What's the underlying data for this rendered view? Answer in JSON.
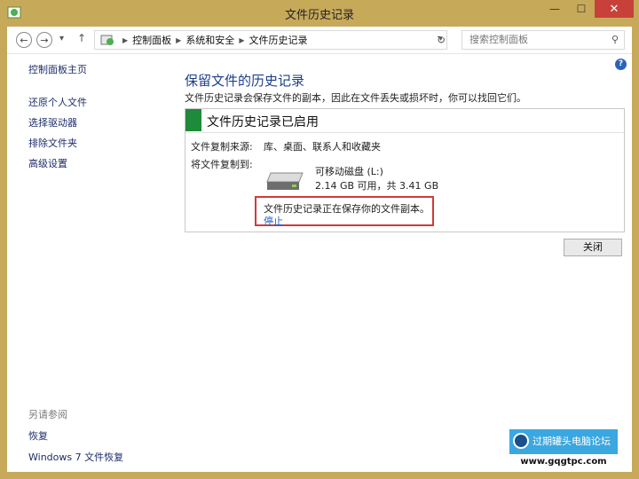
{
  "window": {
    "title": "文件历史记录",
    "minimize": "—",
    "maximize": "☐",
    "close": "✕"
  },
  "address": {
    "crumbs": [
      "控制面板",
      "系统和安全",
      "文件历史记录"
    ],
    "search_placeholder": "搜索控制面板"
  },
  "sidebar": {
    "home": "控制面板主页",
    "items": [
      "还原个人文件",
      "选择驱动器",
      "排除文件夹",
      "高级设置"
    ],
    "see_also_header": "另请参阅",
    "see_also": [
      "恢复",
      "Windows 7 文件恢复"
    ]
  },
  "main": {
    "title": "保留文件的历史记录",
    "description": "文件历史记录会保存文件的副本，因此在文件丢失或损坏时，你可以找回它们。",
    "panel_title": "文件历史记录已启用",
    "source_label": "文件复制来源:",
    "source_value": "库、桌面、联系人和收藏夹",
    "dest_label": "将文件复制到:",
    "drive_name": "可移动磁盘 (L:)",
    "drive_size": "2.14 GB 可用，共 3.41 GB",
    "status": "文件历史记录正在保存你的文件副本。",
    "stop": "停止",
    "close_button": "关闭"
  },
  "watermark": {
    "name": "过期罐头电脑论坛",
    "url": "www.gqgtpc.com"
  },
  "colors": {
    "frame": "#c7a95a",
    "accent_green": "#1e8a3a",
    "highlight_red": "#d23a3a",
    "link": "#1f5fbf"
  }
}
